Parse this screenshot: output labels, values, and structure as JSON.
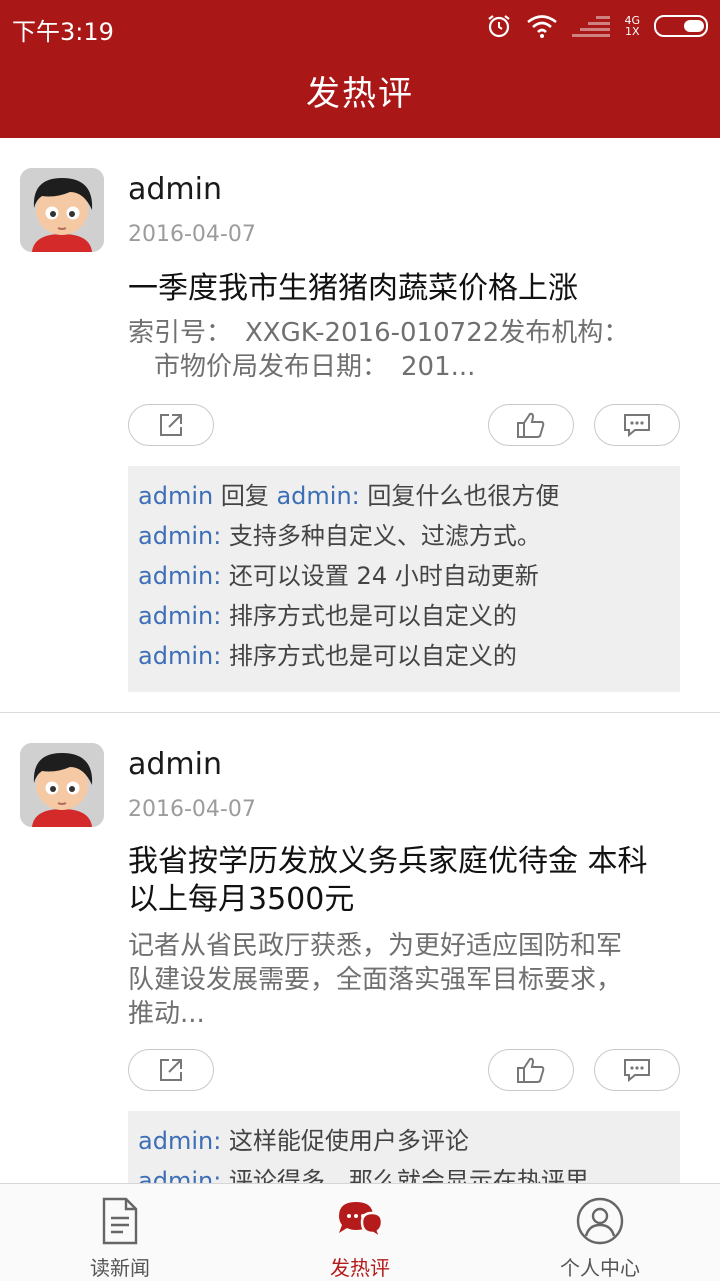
{
  "status_bar": {
    "time": "下午3:19",
    "network_top": "4G",
    "network_bottom": "1X"
  },
  "header": {
    "title": "发热评"
  },
  "posts": [
    {
      "user": "admin",
      "date": "2016-04-07",
      "title": "一季度我市生猪猪肉蔬菜价格上涨",
      "summary_lines": [
        "索引号：　XXGK-2016-010722发布机构：",
        "　市物价局发布日期：　201..."
      ],
      "comments": [
        {
          "user": "admin",
          "reply_word": " 回复 ",
          "reply_to": "admin:",
          "text": " 回复什么也很方便"
        },
        {
          "user": "admin:",
          "text": " 支持多种自定义、过滤方式。"
        },
        {
          "user": "admin:",
          "text": " 还可以设置 24 小时自动更新"
        },
        {
          "user": "admin:",
          "text": " 排序方式也是可以自定义的"
        },
        {
          "user": "admin:",
          "text": " 排序方式也是可以自定义的"
        }
      ]
    },
    {
      "user": "admin",
      "date": "2016-04-07",
      "title_lines": [
        "我省按学历发放义务兵家庭优待金 本科",
        "以上每月3500元"
      ],
      "summary_lines": [
        "记者从省民政厅获悉，为更好适应国防和军",
        "队建设发展需要，全面落实强军目标要求，",
        "推动..."
      ],
      "comments": [
        {
          "user": "admin:",
          "text": " 这样能促使用户多评论"
        },
        {
          "user": "admin:",
          "text": " 评论得多，那么就会显示在热评里"
        }
      ]
    }
  ],
  "tabs": [
    {
      "label": "读新闻",
      "icon": "document-icon"
    },
    {
      "label": "发热评",
      "icon": "chat-bubbles-icon"
    },
    {
      "label": "个人中心",
      "icon": "user-icon"
    }
  ],
  "colors": {
    "brand": "#a91717",
    "link": "#3d6fb6",
    "tab_active": "#b51b1b"
  }
}
